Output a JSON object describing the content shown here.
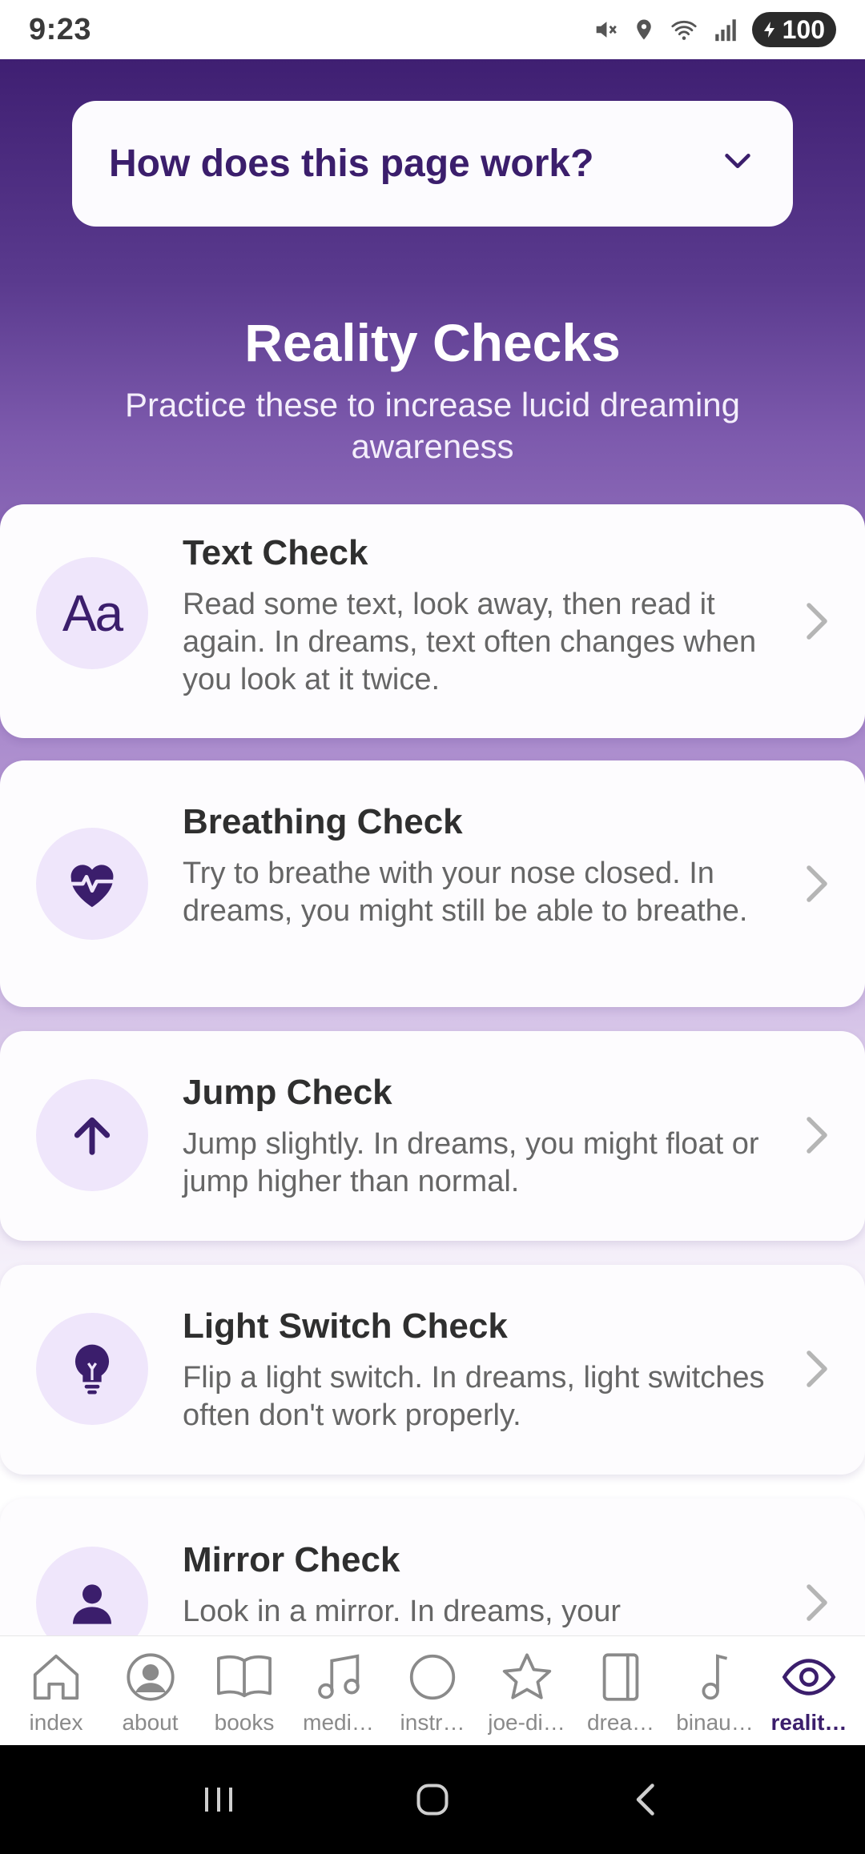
{
  "status_bar": {
    "time": "9:23",
    "battery": "100",
    "icons": [
      "mute-icon",
      "location-icon",
      "wifi-icon",
      "signal-icon",
      "battery-icon"
    ]
  },
  "help": {
    "title": "How does this page work?",
    "icon": "chevron-down-icon"
  },
  "page": {
    "title": "Reality Checks",
    "subtitle": "Practice these to increase lucid dreaming awareness"
  },
  "checks": [
    {
      "title": "Text Check",
      "description": "Read some text, look away, then read it again. In dreams, text often changes when you look at it twice.",
      "icon": "text-aa-icon"
    },
    {
      "title": "Breathing Check",
      "description": "Try to breathe with your nose closed. In dreams, you might still be able to breathe.",
      "icon": "heart-pulse-icon"
    },
    {
      "title": "Jump Check",
      "description": "Jump slightly. In dreams, you might float or jump higher than normal.",
      "icon": "arrow-up-icon"
    },
    {
      "title": "Light Switch Check",
      "description": "Flip a light switch. In dreams, light switches often don't work properly.",
      "icon": "lightbulb-icon"
    },
    {
      "title": "Mirror Check",
      "description": "Look in a mirror. In dreams, your",
      "icon": "person-icon"
    }
  ],
  "aa_text": "Aa",
  "nav": [
    {
      "label": "index",
      "icon": "home-icon",
      "active": false
    },
    {
      "label": "about",
      "icon": "user-circle-icon",
      "active": false
    },
    {
      "label": "books",
      "icon": "book-icon",
      "active": false
    },
    {
      "label": "medi…",
      "icon": "music-note-icon",
      "active": false
    },
    {
      "label": "instr…",
      "icon": "circle-icon",
      "active": false
    },
    {
      "label": "joe-di…",
      "icon": "star-icon",
      "active": false
    },
    {
      "label": "drea…",
      "icon": "tablet-icon",
      "active": false
    },
    {
      "label": "binau…",
      "icon": "single-note-icon",
      "active": false
    },
    {
      "label": "realit…",
      "icon": "eye-icon",
      "active": true
    }
  ],
  "colors": {
    "brand": "#3b1e6c",
    "header_top": "#3f1f72",
    "icon_circle": "#efe6fb",
    "active_nav": "#3b1e6c"
  }
}
